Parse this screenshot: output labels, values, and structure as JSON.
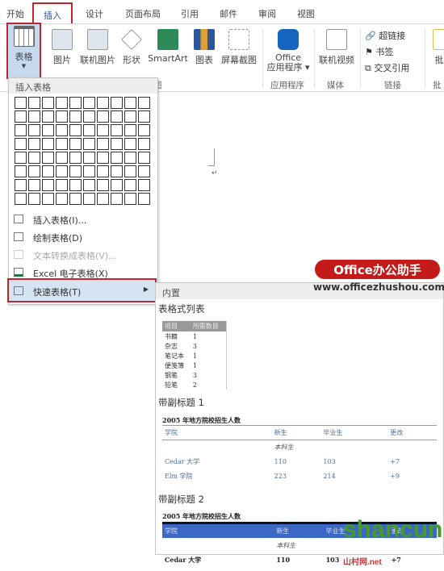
{
  "tabs": [
    "开始",
    "插入",
    "设计",
    "页面布局",
    "引用",
    "邮件",
    "审阅",
    "视图"
  ],
  "ribbon": {
    "table": "表格",
    "picture": "图片",
    "online_picture": "联机图片",
    "shapes": "形状",
    "smartart": "SmartArt",
    "chart": "图表",
    "screenshot": "屏幕截图",
    "office_apps_1": "Office",
    "office_apps_2": "应用程序 ▾",
    "online_video": "联机视频",
    "hyperlink": "超链接",
    "bookmark": "书签",
    "cross_ref": "交叉引用",
    "comment": "批",
    "group_illus": "图",
    "group_apps": "应用程序",
    "group_media": "媒体",
    "group_links": "链接",
    "group_comment": "批"
  },
  "menu": {
    "header": "插入表格",
    "items": [
      {
        "label": "插入表格(I)...",
        "enabled": true
      },
      {
        "label": "绘制表格(D)",
        "enabled": true
      },
      {
        "label": "文本转换成表格(V)...",
        "enabled": false
      },
      {
        "label": "Excel 电子表格(X)",
        "enabled": true
      },
      {
        "label": "快速表格(T)",
        "enabled": true,
        "highlighted": true
      }
    ],
    "grid_cols": 10,
    "grid_rows": 8
  },
  "submenu": {
    "header": "内置",
    "s1": "表格式列表",
    "t1": {
      "headers": [
        "项目",
        "所需数目"
      ],
      "rows": [
        [
          "书籍",
          "1"
        ],
        [
          "杂志",
          "3"
        ],
        [
          "笔记本",
          "1"
        ],
        [
          "便笺簿",
          "1"
        ],
        [
          "钢笔",
          "3"
        ],
        [
          "铅笔",
          "2"
        ]
      ]
    },
    "s2": "带副标题 1",
    "caption": "2005 年地方院校招生人数",
    "t2": {
      "headers": [
        "学院",
        "新生",
        "毕业生",
        "更改"
      ],
      "sub": "本科生",
      "rows": [
        [
          "Cedar 大学",
          "110",
          "103",
          "+7"
        ],
        [
          "Elm 学院",
          "223",
          "214",
          "+9"
        ]
      ]
    },
    "s3": "带副标题 2",
    "t3": {
      "headers": [
        "学院",
        "新生",
        "毕业生",
        "更改"
      ],
      "sub": "本科生",
      "rows": [
        [
          "Cedar 大学",
          "110",
          "103",
          "+7"
        ]
      ]
    }
  },
  "watermarks": {
    "brand": "Office办公助手",
    "url": "www.officezhushou.com",
    "site": "shancun",
    "site_cn": "山村网",
    "site_tld": ".net"
  },
  "colors": {
    "accent": "#2b579a",
    "highlight_outline": "#c0272d"
  }
}
